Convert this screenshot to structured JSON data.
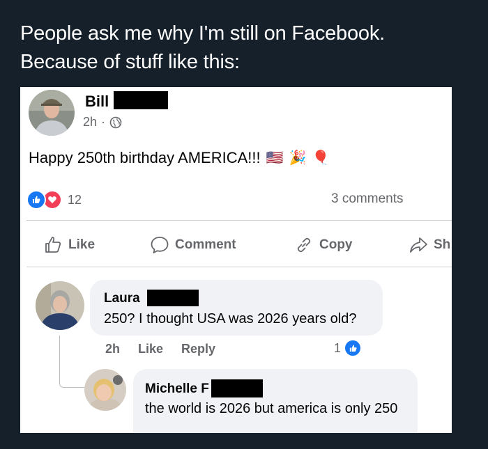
{
  "tweet": {
    "line1": "People ask me why I'm still on Facebook.",
    "line2": "Because of stuff like this:"
  },
  "post": {
    "author": "Bill",
    "time": "2h",
    "separator": "·",
    "privacy_icon": "globe-icon",
    "text": "Happy 250th birthday AMERICA!!!",
    "emojis": [
      "🇺🇸",
      "🎉",
      "🎈"
    ],
    "reaction_icons": [
      "like-icon",
      "love-icon"
    ],
    "reaction_count": "12",
    "comments_count": "3 comments"
  },
  "actions": {
    "like": "Like",
    "comment": "Comment",
    "copy": "Copy",
    "share": "Sh"
  },
  "comments": [
    {
      "name": "Laura",
      "text": "250? I thought USA was 2026 years old?",
      "time": "2h",
      "like_label": "Like",
      "reply_label": "Reply",
      "likes": "1"
    },
    {
      "name": "Michelle",
      "name_suffix": "F",
      "text": "the world is 2026 but america is only 250"
    }
  ],
  "colors": {
    "background": "#15202b",
    "like_blue": "#1877f2",
    "love_red": "#f33e58",
    "meta_grey": "#65676b"
  }
}
